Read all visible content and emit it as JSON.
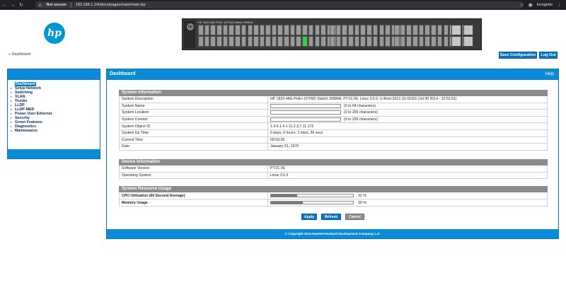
{
  "browser": {
    "security_warning": "Not secure",
    "url": "192.168.1.1/htdocs/pages/main/main.lsp",
    "incognito_label": "Incognito"
  },
  "header": {
    "logo_text": "hp",
    "breadcrumb": "» Dashboard",
    "save_configuration": "Save Configuration",
    "log_out": "Log Out"
  },
  "switch": {
    "label": "HP 1820-48G-PoE+ (370W) Switch J9984A",
    "lit_port": 43
  },
  "sidebar": {
    "items": [
      {
        "label": "Dashboard",
        "active": true,
        "arrow": ""
      },
      {
        "label": "Setup Network",
        "active": false,
        "arrow": "▸"
      },
      {
        "label": "Switching",
        "active": false,
        "arrow": "▸"
      },
      {
        "label": "VLAN",
        "active": false,
        "arrow": "▸"
      },
      {
        "label": "Trunks",
        "active": false,
        "arrow": "▸"
      },
      {
        "label": "LLDP",
        "active": false,
        "arrow": "▸"
      },
      {
        "label": "LLDP-MED",
        "active": false,
        "arrow": "▸"
      },
      {
        "label": "Power Over Ethernet",
        "active": false,
        "arrow": "▸"
      },
      {
        "label": "Security",
        "active": false,
        "arrow": "▸"
      },
      {
        "label": "Green Features",
        "active": false,
        "arrow": "▸"
      },
      {
        "label": "Diagnostics",
        "active": false,
        "arrow": "▸"
      },
      {
        "label": "Maintenance",
        "active": false,
        "arrow": "▸"
      }
    ]
  },
  "main": {
    "title": "Dashboard",
    "help": "Help",
    "footer": "© Copyright 2014 Hewlett-Packard Development Company, L.P."
  },
  "system_info": {
    "heading": "System Information",
    "rows": [
      {
        "label": "System Description",
        "value": "HP 1820-48G-PoE+ (370W) Switch J9984A, PT.01.06, Linux 3.6.5, U-Boot 2012.10-00116 (Jul 30 2014 - 10:52:01)"
      },
      {
        "label": "System Name",
        "hint": "(0 to 64 characters)"
      },
      {
        "label": "System Location",
        "hint": "(0 to 255 characters)"
      },
      {
        "label": "System Contact",
        "hint": "(0 to 255 characters)"
      },
      {
        "label": "System Object ID",
        "value": "1.3.6.1.4.1.11.2.3.7.11.172"
      },
      {
        "label": "System Up Time",
        "value": "0 days, 0 hours, 3 mins, 39 secs"
      },
      {
        "label": "Current Time",
        "value": "00:03:39"
      },
      {
        "label": "Date",
        "value": "January 01, 1970"
      }
    ]
  },
  "device_info": {
    "heading": "Device Information",
    "rows": [
      {
        "label": "Software Version",
        "value": "PT.01.06"
      },
      {
        "label": "Operating System",
        "value": "Linux 3.6.5"
      }
    ]
  },
  "resource_usage": {
    "heading": "System Resource Usage",
    "rows": [
      {
        "label": "CPU Utilization (60 Second Average)",
        "value": "32 %",
        "percent": 32
      },
      {
        "label": "Memory Usage",
        "value": "39 %",
        "percent": 39
      }
    ]
  },
  "actions": {
    "apply": "Apply",
    "refresh": "Refresh",
    "cancel": "Cancel"
  },
  "colors": {
    "accent": "#0b8bd6",
    "button_blue": "#0b74c0",
    "cancel_gray": "#8c8c8c"
  }
}
